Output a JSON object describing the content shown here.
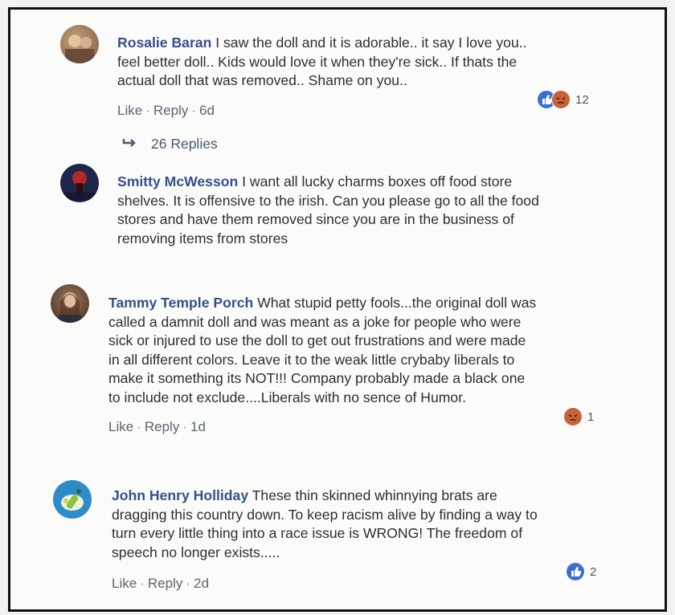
{
  "comments": [
    {
      "author": "Rosalie Baran",
      "lines": [
        " I saw the doll and it is adorable.. it say I love you..",
        "feel better doll.. Kids would love it when they're sick.. If thats the",
        "actual doll that was removed.. Shame on you.."
      ],
      "actions": {
        "like": "Like",
        "reply": "Reply",
        "time": "6d"
      },
      "reaction_count": "12",
      "replies_label": "26 Replies"
    },
    {
      "author": "Smitty McWesson",
      "lines": [
        " I want all lucky charms boxes off food store",
        "shelves. It is offensive to the irish. Can you please go to all the food",
        "stores and have them removed since you are in the business of",
        "removing items from stores"
      ]
    },
    {
      "author": "Tammy Temple Porch",
      "lines": [
        " What stupid petty fools...the original doll was",
        "called a damnit doll and was meant as a joke for people who were",
        "sick or injured to use the doll to get out frustrations and were made",
        "in all different colors. Leave it to the weak little crybaby liberals to",
        "make it something its NOT!!! Company probably made a black one",
        "to include not exclude....Liberals with no sence of Humor."
      ],
      "actions": {
        "like": "Like",
        "reply": "Reply",
        "time": "1d"
      },
      "reaction_count": "1"
    },
    {
      "author": "John Henry Holliday",
      "lines": [
        " These thin skinned whinnying brats are",
        "dragging this country down. To keep racism alive by finding a way to",
        "turn every little thing into a race issue is WRONG! The freedom of",
        "speech no longer exists....."
      ],
      "actions": {
        "like": "Like",
        "reply": "Reply",
        "time": "2d"
      },
      "reaction_count": "2"
    }
  ],
  "colors": {
    "name": "#36508a",
    "like": "#3b6fd0",
    "angry": "#c8623a",
    "border": "#111111"
  },
  "icons": {
    "like": "thumbs-up-icon",
    "angry": "angry-face-icon",
    "reply_arrow": "reply-arrow-icon"
  }
}
